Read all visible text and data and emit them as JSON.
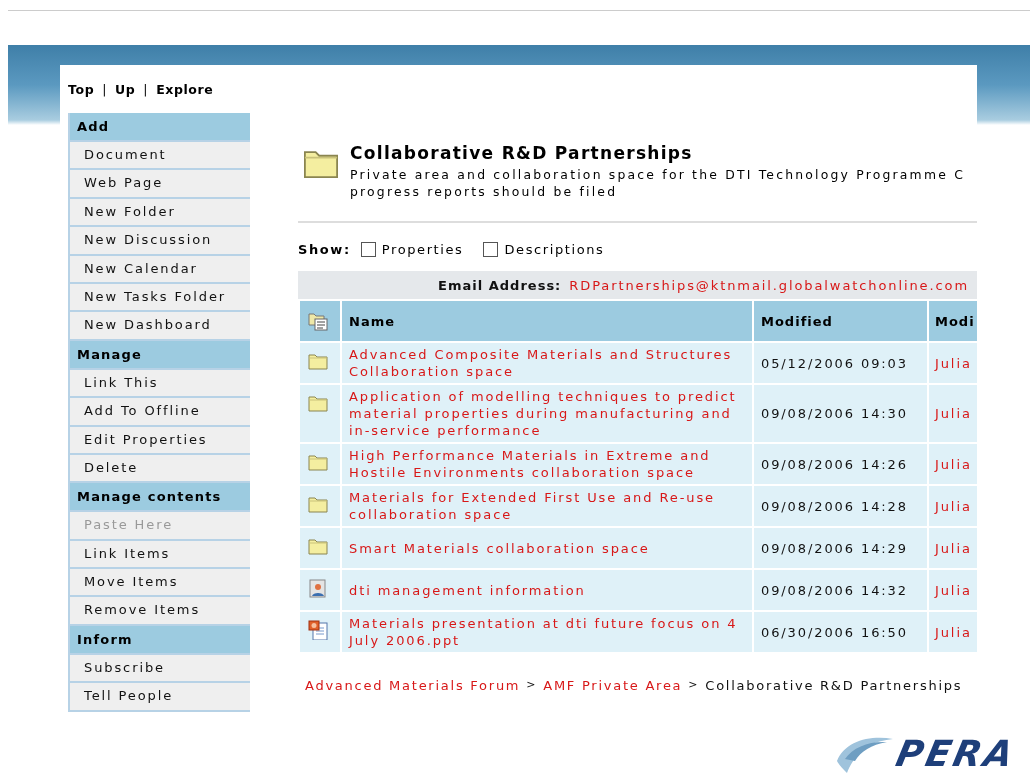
{
  "nav": [
    {
      "kind": "link",
      "label": "Top"
    },
    {
      "kind": "separator",
      "label": "|"
    },
    {
      "kind": "link",
      "label": "Up"
    },
    {
      "kind": "separator",
      "label": "|"
    },
    {
      "kind": "link",
      "label": "Explore"
    }
  ],
  "sidebar": {
    "sections": [
      {
        "title": "Add",
        "items": [
          {
            "label": "Document",
            "disabled": false
          },
          {
            "label": "Web Page",
            "disabled": false
          },
          {
            "label": "New Folder",
            "disabled": false
          },
          {
            "label": "New Discussion",
            "disabled": false
          },
          {
            "label": "New Calendar",
            "disabled": false
          },
          {
            "label": "New Tasks Folder",
            "disabled": false
          },
          {
            "label": "New Dashboard",
            "disabled": false
          }
        ]
      },
      {
        "title": "Manage",
        "items": [
          {
            "label": "Link This",
            "disabled": false
          },
          {
            "label": "Add To Offline",
            "disabled": false
          },
          {
            "label": "Edit Properties",
            "disabled": false
          },
          {
            "label": "Delete",
            "disabled": false
          }
        ]
      },
      {
        "title": "Manage contents",
        "items": [
          {
            "label": "Paste Here",
            "disabled": true
          },
          {
            "label": "Link Items",
            "disabled": false
          },
          {
            "label": "Move Items",
            "disabled": false
          },
          {
            "label": "Remove Items",
            "disabled": false
          }
        ]
      },
      {
        "title": "Inform",
        "items": [
          {
            "label": "Subscribe",
            "disabled": false
          },
          {
            "label": "Tell People",
            "disabled": false
          }
        ]
      }
    ]
  },
  "folder": {
    "title": "Collaborative R&D Partnerships",
    "description_lines": [
      "Private area and collaboration space for the DTI Technology Programme C",
      "progress reports should be filed"
    ]
  },
  "show": {
    "label": "Show:",
    "options": [
      {
        "label": "Properties",
        "checked": false
      },
      {
        "label": "Descriptions",
        "checked": false
      }
    ]
  },
  "table": {
    "email_label": "Email Address:",
    "email": "RDPartnerships@ktnmail.globalwatchonline.com",
    "columns": [
      {
        "kind": "icon"
      },
      {
        "kind": "text",
        "label": "Name"
      },
      {
        "kind": "text",
        "label": "Modified"
      },
      {
        "kind": "text",
        "label": "Modi"
      }
    ],
    "rows": [
      {
        "kind": "folder",
        "name": "Advanced Composite Materials and Structures Collaboration space",
        "modified": "05/12/2006 09:03",
        "modified_by": "Julia"
      },
      {
        "kind": "folder",
        "name": "Application of modelling techniques to predict material properties during manufacturing and in-service performance",
        "modified": "09/08/2006 14:30",
        "modified_by": "Julia"
      },
      {
        "kind": "folder",
        "name": "High Performance Materials in Extreme and Hostile Environments collaboration space",
        "modified": "09/08/2006 14:26",
        "modified_by": "Julia"
      },
      {
        "kind": "folder",
        "name": "Materials for Extended First Use and Re-use collaboration space",
        "modified": "09/08/2006 14:28",
        "modified_by": "Julia"
      },
      {
        "kind": "folder",
        "name": "Smart Materials collaboration space",
        "modified": "09/08/2006 14:29",
        "modified_by": "Julia"
      },
      {
        "kind": "person",
        "name": "dti management information",
        "modified": "09/08/2006 14:32",
        "modified_by": "Julia"
      },
      {
        "kind": "presentation",
        "name": "Materials presentation at dti future focus on 4 July 2006.ppt",
        "modified": "06/30/2006 16:50",
        "modified_by": "Julia"
      }
    ]
  },
  "breadcrumb": [
    {
      "kind": "link",
      "label": "Advanced Materials Forum"
    },
    {
      "kind": "separator",
      "label": ">"
    },
    {
      "kind": "link",
      "label": "AMF Private Area"
    },
    {
      "kind": "separator",
      "label": ">"
    },
    {
      "kind": "current",
      "label": "Collaborative R&D Partnerships"
    }
  ],
  "logo": {
    "text": "PERA"
  }
}
